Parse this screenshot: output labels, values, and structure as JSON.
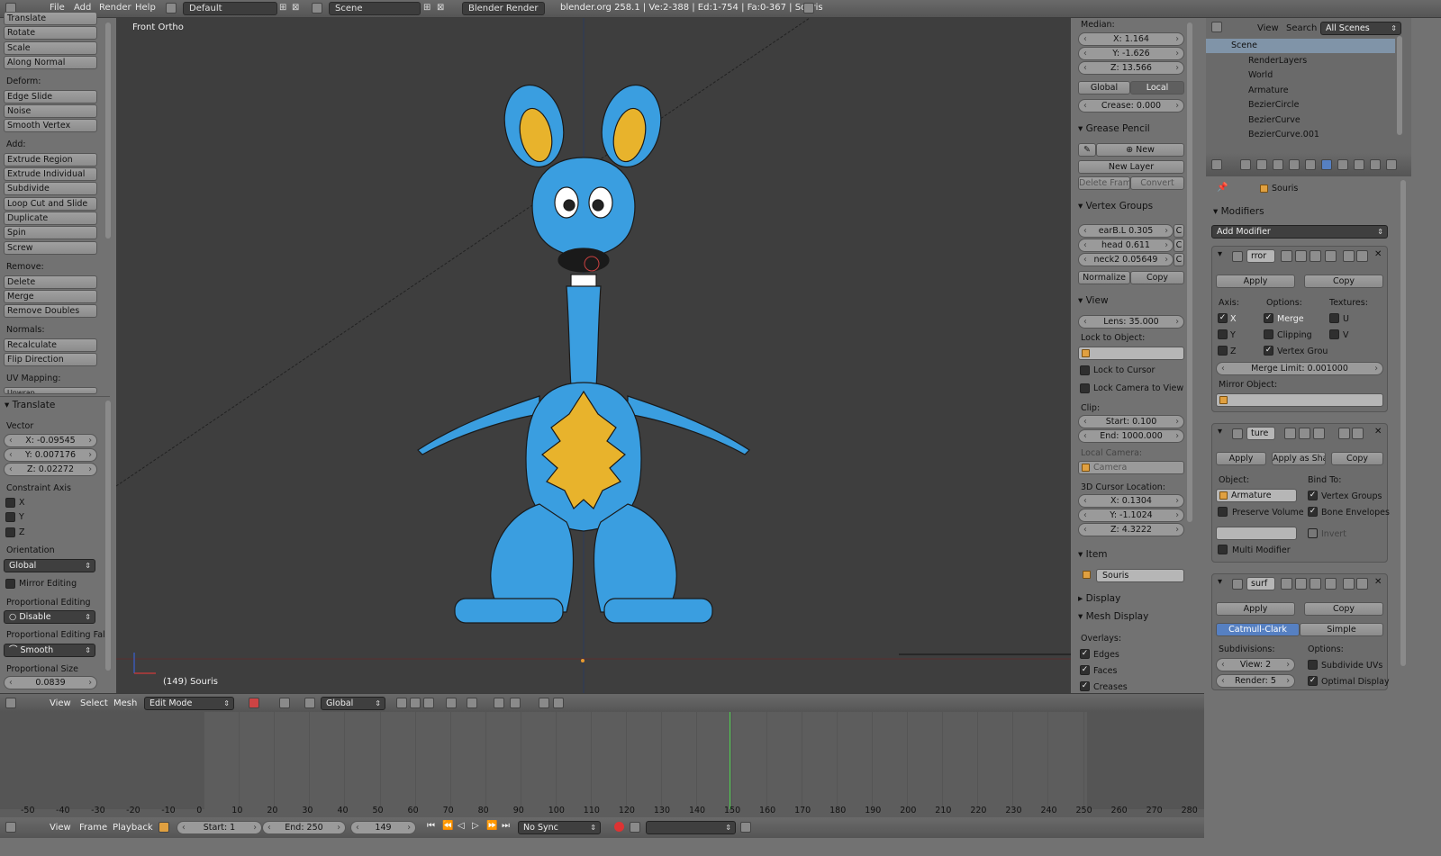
{
  "topbar": {
    "menus": [
      "File",
      "Add",
      "Render",
      "Help"
    ],
    "layout": "Default",
    "scene": "Scene",
    "engine": "Blender Render",
    "info": "blender.org 258.1 | Ve:2-388 | Ed:1-754 | Fa:0-367 | Souris"
  },
  "toolshelf": {
    "transform_top": "Translate",
    "items_a": [
      "Rotate",
      "Scale",
      "Along Normal"
    ],
    "deform_label": "Deform:",
    "deform": [
      "Edge Slide",
      "Noise",
      "Smooth Vertex"
    ],
    "add_label": "Add:",
    "add": [
      "Extrude Region",
      "Extrude Individual",
      "Subdivide",
      "Loop Cut and Slide",
      "Duplicate",
      "Spin",
      "Screw"
    ],
    "remove_label": "Remove:",
    "remove": [
      "Delete",
      "Merge",
      "Remove Doubles"
    ],
    "normals_label": "Normals:",
    "normals": [
      "Recalculate",
      "Flip Direction"
    ],
    "uv_label": "UV Mapping:",
    "uv": "Unwrap",
    "op_title": "Translate",
    "vector_label": "Vector",
    "vx": "X: -0.09545",
    "vy": "Y: 0.007176",
    "vz": "Z: 0.02272",
    "constraint_label": "Constraint Axis",
    "cx": "X",
    "cy": "Y",
    "cz": "Z",
    "orientation_label": "Orientation",
    "orientation": "Global",
    "mirror": "Mirror Editing",
    "prop_label": "Proportional Editing",
    "prop": "Disable",
    "falloff_label": "Proportional Editing Fall",
    "falloff": "Smooth",
    "size_label": "Proportional Size",
    "size": "0.0839"
  },
  "viewport": {
    "view_name": "Front Ortho",
    "object": "(149) Souris"
  },
  "npanel": {
    "median": "Median:",
    "mx": "X: 1.164",
    "my": "Y: -1.626",
    "mz": "Z: 13.566",
    "global": "Global",
    "local": "Local",
    "crease": "Crease: 0.000",
    "gp_title": "Grease Pencil",
    "gp_new": "New",
    "gp_newlayer": "New Layer",
    "gp_delete": "Delete Frame",
    "gp_convert": "Convert",
    "vg_title": "Vertex Groups",
    "vg": [
      "earB.L 0.305",
      "head 0.611",
      "neck2 0.05649"
    ],
    "vg_c": "C",
    "normalize": "Normalize",
    "copy": "Copy",
    "view_title": "View",
    "lens": "Lens: 35.000",
    "lock_obj": "Lock to Object:",
    "lock_cursor": "Lock to Cursor",
    "lock_cam": "Lock Camera to View",
    "clip": "Clip:",
    "clip_start": "Start: 0.100",
    "clip_end": "End: 1000.000",
    "local_cam": "Local Camera:",
    "camera": "Camera",
    "cursor": "3D Cursor Location:",
    "cx": "X: 0.1304",
    "cy": "Y: -1.1024",
    "cz": "Z: 4.3222",
    "item_title": "Item",
    "item_name": "Souris",
    "display_title": "Display",
    "mesh_display": "Mesh Display",
    "overlays": "Overlays:",
    "edges": "Edges",
    "faces": "Faces",
    "creases": "Creases"
  },
  "vpheader": {
    "view": "View",
    "select": "Select",
    "mesh": "Mesh",
    "mode": "Edit Mode",
    "orient": "Global"
  },
  "timeline": {
    "ticks": [
      "-50",
      "-40",
      "-30",
      "-20",
      "-10",
      "0",
      "10",
      "20",
      "30",
      "40",
      "50",
      "60",
      "70",
      "80",
      "90",
      "100",
      "110",
      "120",
      "130",
      "140",
      "150",
      "160",
      "170",
      "180",
      "190",
      "200",
      "210",
      "220",
      "230",
      "240",
      "250",
      "260",
      "270",
      "280"
    ],
    "view": "View",
    "frame": "Frame",
    "playback": "Playback",
    "start": "Start: 1",
    "end": "End: 250",
    "current": "149",
    "sync": "No Sync"
  },
  "outliner": {
    "view": "View",
    "search": "Search",
    "filter": "All Scenes",
    "rows": [
      "Scene",
      "RenderLayers",
      "World",
      "Armature",
      "BezierCircle",
      "BezierCurve",
      "BezierCurve.001"
    ]
  },
  "props": {
    "object": "Souris",
    "modifiers": "Modifiers",
    "add_modifier": "Add Modifier",
    "m1": {
      "name": "rror",
      "apply": "Apply",
      "copy": "Copy",
      "axis": "Axis:",
      "options": "Options:",
      "textures": "Textures:",
      "x": "X",
      "y": "Y",
      "z": "Z",
      "merge": "Merge",
      "clipping": "Clipping",
      "vgroups": "Vertex Grou",
      "u": "U",
      "v": "V",
      "merge_limit": "Merge Limit: 0.001000",
      "mirror_obj": "Mirror Object:"
    },
    "m2": {
      "name": "ture",
      "apply": "Apply",
      "apply_shape": "Apply as Shap",
      "copy": "Copy",
      "object": "Object:",
      "bind": "Bind To:",
      "armature": "Armature",
      "vgroups": "Vertex Groups",
      "preserve": "Preserve Volume",
      "envelopes": "Bone Envelopes",
      "invert": "Invert",
      "multi": "Multi Modifier"
    },
    "m3": {
      "name": "surf",
      "apply": "Apply",
      "copy": "Copy",
      "cc": "Catmull-Clark",
      "simple": "Simple",
      "subdiv": "Subdivisions:",
      "options": "Options:",
      "view": "View: 2",
      "render": "Render: 5",
      "subuv": "Subdivide UVs",
      "optimal": "Optimal Display"
    }
  },
  "colors": {
    "blue": "#3a9ee0",
    "yellow": "#e8b32c",
    "bg": "#727272",
    "viewport": "#3e3e3e",
    "accent": "#5680c2"
  }
}
